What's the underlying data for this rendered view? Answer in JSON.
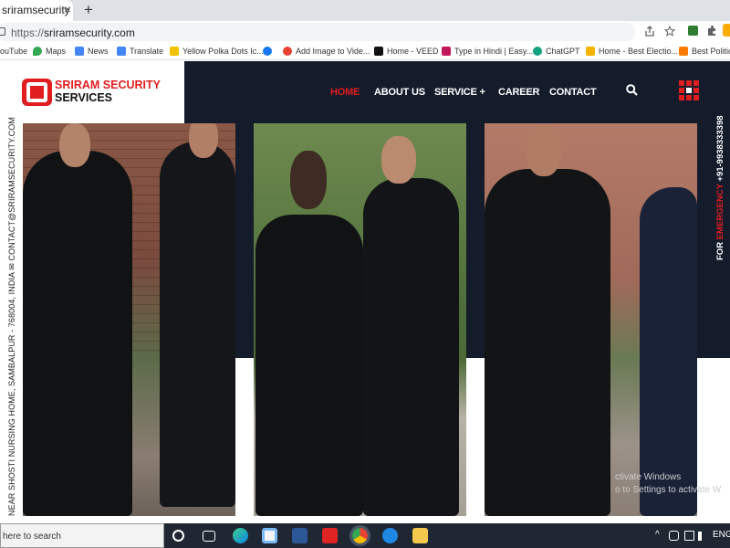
{
  "browser": {
    "tab_title": "sriramsecurity",
    "tab_close": "×",
    "new_tab": "+",
    "url_protocol": "https://",
    "url_domain": "sriramsecurity.com",
    "bookmarks": [
      {
        "label": "ouTube",
        "color": "#ff0000"
      },
      {
        "label": "Maps",
        "color": "#34a853"
      },
      {
        "label": "News",
        "color": "#4285f4"
      },
      {
        "label": "Translate",
        "color": "#4285f4"
      },
      {
        "label": "Yellow Polka Dots Ic...",
        "color": "#f2c200"
      },
      {
        "label": "",
        "color": "#1877f2"
      },
      {
        "label": "Add Image to Vide...",
        "color": "#e94235"
      },
      {
        "label": "Home - VEED",
        "color": "#111111"
      },
      {
        "label": "Type in Hindi | Easy...",
        "color": "#c2185b"
      },
      {
        "label": "ChatGPT",
        "color": "#10a37f"
      },
      {
        "label": "Home - Best Electio...",
        "color": "#f4b400"
      },
      {
        "label": "Best Political",
        "color": "#ff7a00"
      }
    ]
  },
  "site": {
    "logo_line1": "SRIRAM SECURITY",
    "logo_line2": "SERVICES",
    "nav": {
      "home": "HOME",
      "about": "ABOUT US",
      "service": "SERVICE +",
      "career": "CAREER",
      "contact": "CONTACT"
    },
    "left_vertical": "NEAR SHOSTI NURSING HOME, SAMBALPUR - 768004, INDIA ✉  CONTACT@SRIRAMSECURITY.COM",
    "right_vertical_prefix": "FOR ",
    "right_vertical_emphasis": "EMERGENCY",
    "right_vertical_suffix": " +91-9938333398",
    "watermark_l1": "ctivate Windows",
    "watermark_l2": "o to Settings to activate W",
    "colors": {
      "accent": "#e11d20",
      "dark": "#141b2b"
    }
  },
  "taskbar": {
    "search_placeholder": "here to search",
    "lang": "ENG",
    "tray_arrow": "^"
  }
}
